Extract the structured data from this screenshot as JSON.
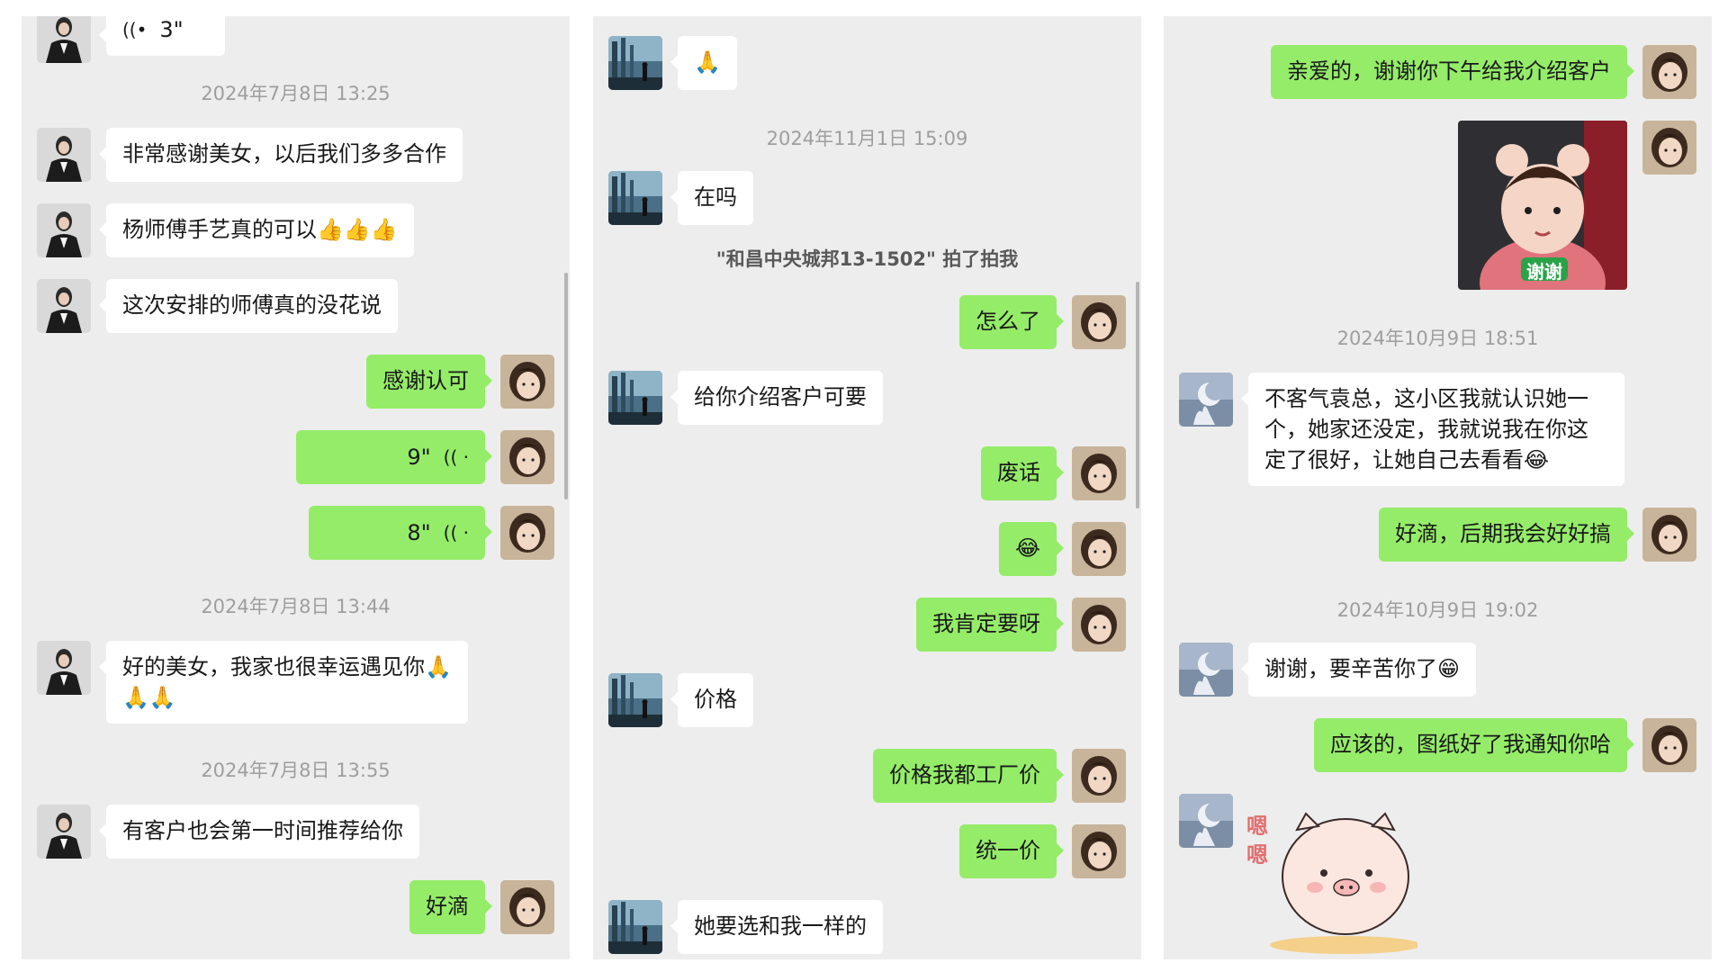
{
  "panel1": {
    "voice_top": "3\"",
    "voice_top_icon": "sound-wave-icon",
    "ts1": "2024年7月8日 13:25",
    "msg1": "非常感谢美女，以后我们多多合作",
    "msg2": "杨师傅手艺真的可以👍👍👍",
    "msg3": "这次安排的师傅真的没花说",
    "reply1": "感谢认可",
    "voice1": "9\"",
    "voice2": "8\"",
    "ts2": "2024年7月8日 13:44",
    "msg4_line1": "好的美女，我家也很幸运遇见你🙏",
    "msg4_line2": "🙏🙏",
    "ts3": "2024年7月8日 13:55",
    "msg5": "有客户也会第一时间推荐给你",
    "reply2": "好滴"
  },
  "panel2": {
    "msg1": "🙏",
    "ts1": "2024年11月1日 15:09",
    "msg2": "在吗",
    "sys1": "\"和昌中央城邦13-1502\" 拍了拍我",
    "reply1": "怎么了",
    "msg3": "给你介绍客户可要",
    "reply2": "废话",
    "reply3": "😂",
    "reply4": "我肯定要呀",
    "msg4": "价格",
    "reply5": "价格我都工厂价",
    "reply6": "统一价",
    "msg5": "她要选和我一样的"
  },
  "panel3": {
    "reply1": "亲爱的，谢谢你下午给我介绍客户",
    "sticker1_text": "谢谢",
    "ts1": "2024年10月9日 18:51",
    "msg1_line1": "不客气袁总，这小区我就认识她一",
    "msg1_line2": "个，她家还没定，我就说我在你这",
    "msg1_line3": "定了很好，让她自己去看看😂",
    "reply2": "好滴，后期我会好好搞",
    "ts2": "2024年10月9日 19:02",
    "msg2": "谢谢，要辛苦你了😁",
    "reply3": "应该的，图纸好了我通知你哈",
    "sticker2_text": "嗯嗯"
  },
  "colors": {
    "bubble_out": "#95ec69",
    "bubble_in": "#ffffff",
    "bg": "#ededed",
    "timestamp": "#9e9e9e"
  }
}
